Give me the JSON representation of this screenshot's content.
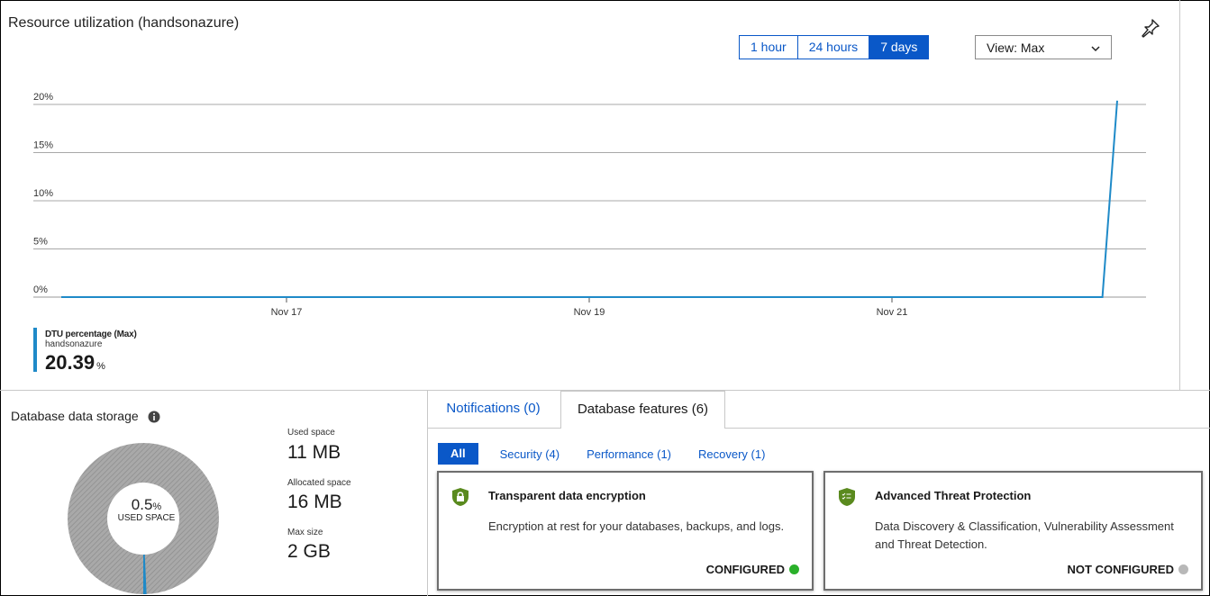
{
  "resource": {
    "title": "Resource utilization (handsonazure)",
    "time_buttons": [
      "1 hour",
      "24 hours",
      "7 days"
    ],
    "active_time": "7 days",
    "view_select": "View: Max",
    "legend": {
      "metric": "DTU percentage (Max)",
      "resource": "handsonazure",
      "value": "20.39",
      "unit": "%"
    }
  },
  "chart_data": {
    "type": "line",
    "ylim": [
      0,
      20
    ],
    "y_ticks": [
      "20%",
      "15%",
      "10%",
      "5%",
      "0%"
    ],
    "x_ticks": [
      "Nov 17",
      "Nov 19",
      "Nov 21"
    ],
    "series": [
      {
        "name": "DTU percentage (Max)",
        "color": "#1f8ac8",
        "points": [
          [
            0,
            0
          ],
          [
            0.986,
            0
          ],
          [
            1.0,
            20.39
          ]
        ]
      }
    ]
  },
  "storage": {
    "title": "Database data storage",
    "donut_pct": "0.5",
    "donut_unit": "%",
    "donut_label": "USED SPACE",
    "used_pct": 0.5,
    "used_label": "Used space",
    "used_value": "11 MB",
    "allocated_label": "Allocated space",
    "allocated_value": "16 MB",
    "max_label": "Max size",
    "max_value": "2 GB"
  },
  "tabs": {
    "notifications": "Notifications (0)",
    "features": "Database features (6)"
  },
  "filters": {
    "all": "All",
    "security": "Security (4)",
    "performance": "Performance (1)",
    "recovery": "Recovery (1)"
  },
  "cards": [
    {
      "title": "Transparent data encryption",
      "desc": "Encryption at rest for your databases, backups, and logs.",
      "status": "CONFIGURED",
      "status_color": "#2ab02a",
      "icon": "lock-shield-icon"
    },
    {
      "title": "Advanced Threat Protection",
      "desc": "Data Discovery & Classification, Vulnerability Assessment and Threat Detection.",
      "status": "NOT CONFIGURED",
      "status_color": "#b8b8b8",
      "icon": "checklist-shield-icon"
    }
  ],
  "colors": {
    "accent": "#0a58c8",
    "series": "#1f8ac8",
    "shield": "#5a8a1e"
  }
}
